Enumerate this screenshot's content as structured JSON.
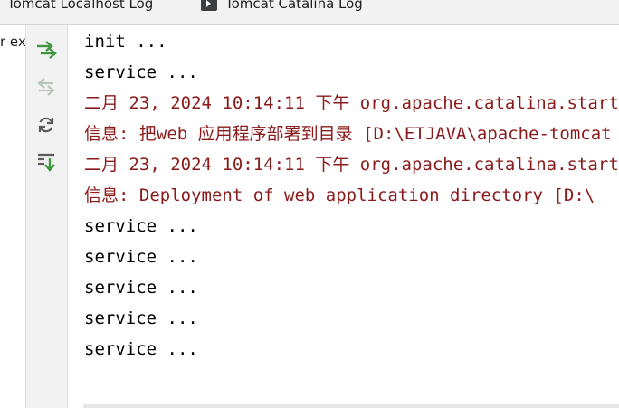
{
  "tabs": [
    {
      "label": "Tomcat Localhost Log"
    },
    {
      "label": "Tomcat Catalina Log"
    }
  ],
  "left_panel": {
    "label": "r ex"
  },
  "toolbar": {
    "rerun_icon": "rerun-icon",
    "stop_icon": "stop-icon",
    "refresh_icon": "refresh-icon",
    "scroll_icon": "scroll-to-end-icon"
  },
  "console": {
    "lines": [
      {
        "text": "init ...",
        "type": "out"
      },
      {
        "text": "service ...",
        "type": "out"
      },
      {
        "text": "二月 23, 2024 10:14:11 下午 org.apache.catalina.startup.HostConfig deployDirectory",
        "type": "err"
      },
      {
        "text": "信息: 把web 应用程序部署到目录 [D:\\ETJAVA\\apache-tomcat",
        "type": "err"
      },
      {
        "text": "二月 23, 2024 10:14:11 下午 org.apache.catalina.startup.HostConfig deployDirectory",
        "type": "err"
      },
      {
        "text": "信息: Deployment of web application directory [D:\\",
        "type": "err"
      },
      {
        "text": "service ...",
        "type": "out"
      },
      {
        "text": "service ...",
        "type": "out"
      },
      {
        "text": "service ...",
        "type": "out"
      },
      {
        "text": "service ...",
        "type": "out"
      },
      {
        "text": "service ...",
        "type": "out"
      }
    ]
  },
  "colors": {
    "stdout": "#000000",
    "stderr": "#8b1a1a",
    "icon_green": "#3f9a3f"
  }
}
